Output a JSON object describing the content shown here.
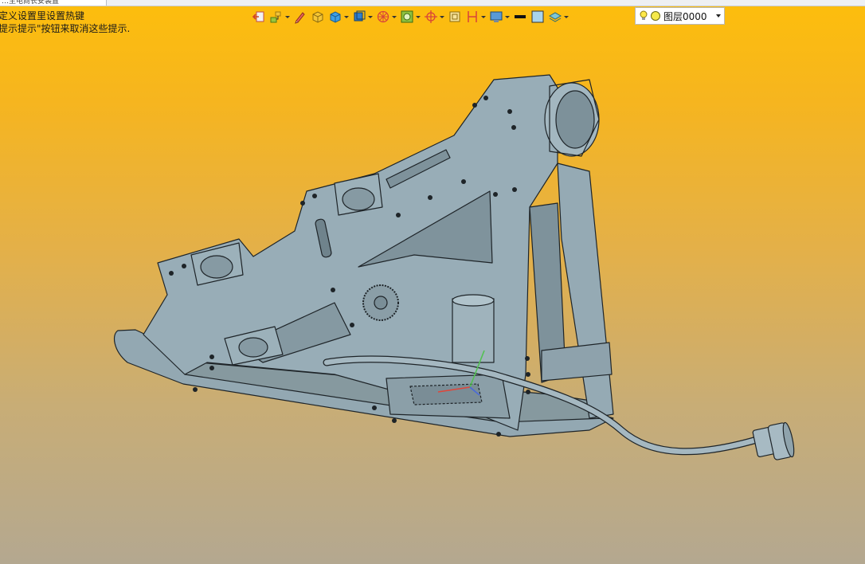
{
  "tab": {
    "title": "…主电商长安装置"
  },
  "hint": {
    "line1": "定义设置里设置热键",
    "line2": "提示提示\"按钮来取消这些提示."
  },
  "toolbar": {
    "buttons": [
      {
        "name": "exit-icon",
        "has_menu": false
      },
      {
        "name": "tree-icon",
        "has_menu": true
      },
      {
        "name": "pen-icon",
        "has_menu": false
      },
      {
        "name": "yellow-cube-icon",
        "has_menu": false
      },
      {
        "name": "blue-cube-icon",
        "has_menu": true
      },
      {
        "name": "view-cube-icon",
        "has_menu": true
      },
      {
        "name": "wheel-icon",
        "has_menu": true
      },
      {
        "name": "render-icon",
        "has_menu": true
      },
      {
        "name": "crosshair-icon",
        "has_menu": true
      },
      {
        "name": "frame-icon",
        "has_menu": false
      },
      {
        "name": "dimension-icon",
        "has_menu": true
      },
      {
        "name": "display-icon",
        "has_menu": true
      },
      {
        "name": "line-style-icon",
        "has_menu": false
      },
      {
        "name": "color-swatch-icon",
        "has_menu": false
      },
      {
        "name": "layers-icon",
        "has_menu": true
      }
    ],
    "colors": {
      "line_color": "#111111",
      "swatch_fill": "#a8d4ec"
    }
  },
  "layer": {
    "label": "图层0000",
    "lightbulb_color": "#ffe94a",
    "dot_color": "#f5e94a"
  },
  "viewport": {
    "background_top": "#fdbe0c",
    "background_bottom": "#b4a890",
    "model_fill": "#8fa4ae",
    "model_stroke": "#1e2428"
  }
}
